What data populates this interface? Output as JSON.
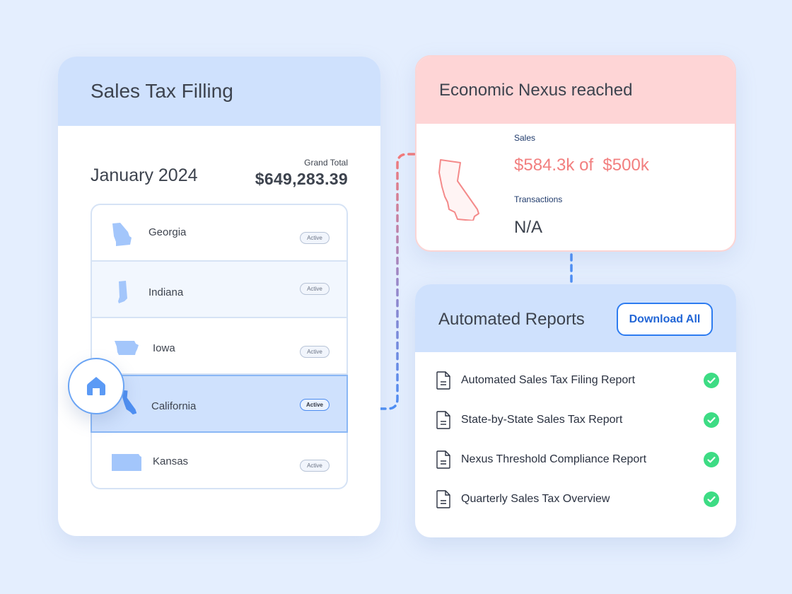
{
  "filing_card": {
    "title": "Sales Tax Filling",
    "period": "January 2024",
    "grand_total_label": "Grand Total",
    "grand_total_value": "$649,283.39",
    "states": [
      {
        "name": "Georgia",
        "status": "Active",
        "selected": false
      },
      {
        "name": "Indiana",
        "status": "Active",
        "selected": false
      },
      {
        "name": "Iowa",
        "status": "Active",
        "selected": false
      },
      {
        "name": "California",
        "status": "Active",
        "selected": true
      },
      {
        "name": "Kansas",
        "status": "Active",
        "selected": false
      }
    ],
    "home_icon": "home-icon"
  },
  "nexus_card": {
    "title": "Economic Nexus reached",
    "state_icon": "california-outline-icon",
    "sales_label": "Sales",
    "sales_value": "$584.3k of  $500k",
    "transactions_label": "Transactions",
    "transactions_value": "N/A"
  },
  "reports_card": {
    "title": "Automated Reports",
    "download_label": "Download All",
    "reports": [
      {
        "name": "Automated Sales Tax Filing Report",
        "status": "complete"
      },
      {
        "name": "State-by-State Sales Tax Report",
        "status": "complete"
      },
      {
        "name": "Nexus Threshold Compliance Report",
        "status": "complete"
      },
      {
        "name": "Quarterly Sales Tax Overview",
        "status": "complete"
      }
    ]
  },
  "colors": {
    "background": "#e4eefe",
    "header_blue": "#cfe1fd",
    "header_pink": "#fed5d6",
    "accent_blue": "#2e7cf0",
    "alert_red": "#f27f7f",
    "success_green": "#3ddc84"
  }
}
